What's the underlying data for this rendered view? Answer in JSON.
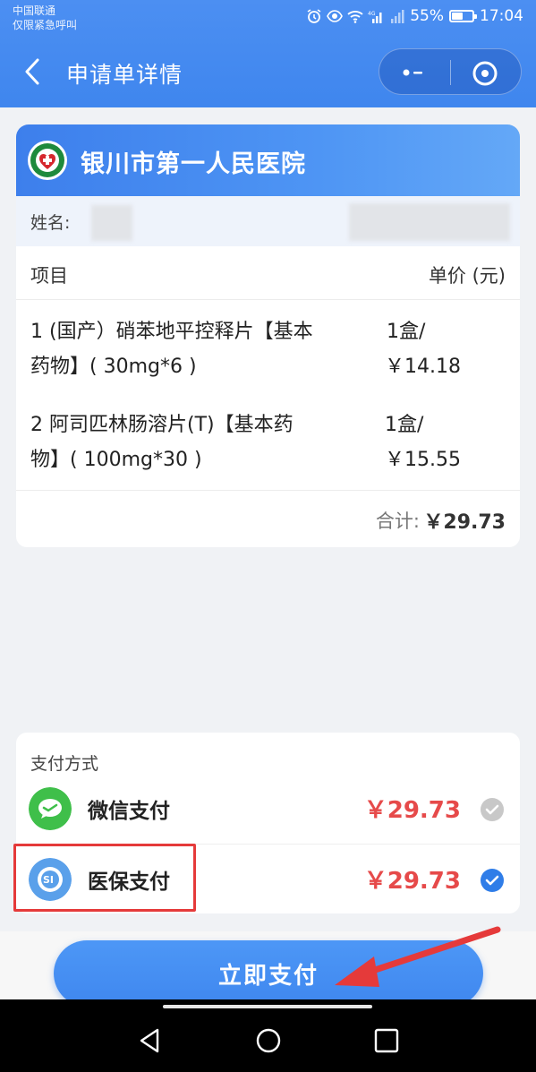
{
  "status_bar": {
    "carrier": "中国联通",
    "emergency": "仅限紧急呼叫",
    "battery_pct": "55%",
    "battery_level": 0.55,
    "time": "17:04",
    "icons": [
      "alarm-icon",
      "eye-icon",
      "wifi-icon",
      "signal-4g-icon",
      "signal-icon"
    ]
  },
  "header": {
    "title": "申请单详情",
    "back_icon": "chevron-left-icon",
    "capsule_icons": [
      "more-dots-icon",
      "close-circle-icon"
    ]
  },
  "hospital": {
    "name": "银川市第一人民医院",
    "name_label": "姓名:"
  },
  "items": {
    "col_project": "项目",
    "col_price": "单价 (元)",
    "rows": [
      {
        "name_line1": "1 (国产）硝苯地平控释片【基本",
        "name_line2": "药物】( 30mg*6 )",
        "qty": "1盒/",
        "price": "￥14.18"
      },
      {
        "name_line1": "2 阿司匹林肠溶片(T)【基本药",
        "name_line2": "物】( 100mg*30 )",
        "qty": "1盒/",
        "price": "￥15.55"
      }
    ],
    "total_label": "合计:",
    "total_value": "￥29.73"
  },
  "payment": {
    "title": "支付方式",
    "options": [
      {
        "label": "微信支付",
        "amount": "￥29.73",
        "icon": "wechat-pay-icon",
        "selected": false
      },
      {
        "label": "医保支付",
        "amount": "￥29.73",
        "icon": "medical-insurance-icon",
        "selected": true
      }
    ]
  },
  "action": {
    "pay_now": "立即支付"
  },
  "colors": {
    "brand_blue": "#3f86ee",
    "amount_red": "#e64a4a",
    "wechat_green": "#3fbf4a",
    "highlight_red": "#e53a3a"
  }
}
